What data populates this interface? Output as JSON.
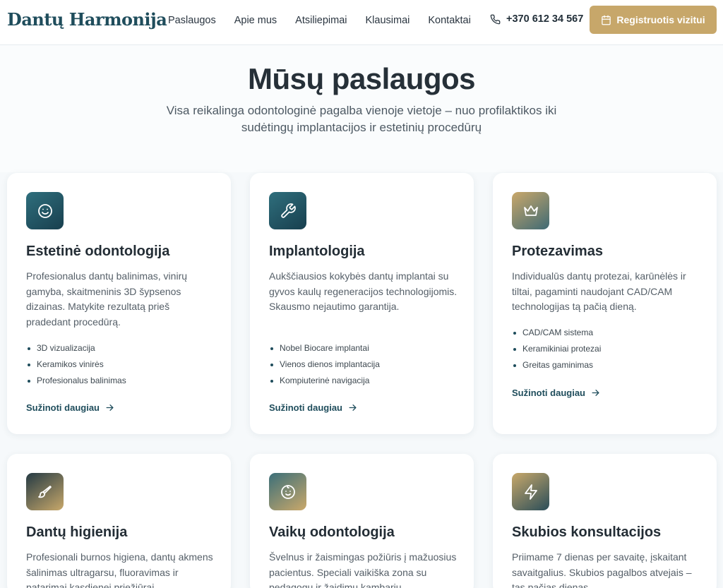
{
  "header": {
    "logo": "Dantų Harmonija",
    "nav": [
      "Paslaugos",
      "Apie mus",
      "Atsiliepimai",
      "Klausimai",
      "Kontaktai"
    ],
    "phone": "+370 612 34 567",
    "cta_label": "Registruotis vizitui"
  },
  "hero": {
    "title": "Mūsų paslaugos",
    "subtitle": "Visa reikalinga odontologinė pagalba vienoje vietoje – nuo profilaktikos iki sudėtingų implantacijos ir estetinių procedūrų"
  },
  "cards": [
    {
      "icon": "smile-icon",
      "title": "Estetinė odontologija",
      "text": "Profesionalus dantų balinimas, vinirų gamyba, skaitmeninis 3D šypsenos dizainas. Matykite rezultatą prieš pradedant procedūrą.",
      "features": [
        "3D vizualizacija",
        "Keramikos vinirės",
        "Profesionalus balinimas"
      ],
      "link": "Sužinoti daugiau"
    },
    {
      "icon": "wrench-icon",
      "title": "Implantologija",
      "text": "Aukščiausios kokybės dantų implantai su gyvos kaulų regeneracijos technologijomis. Skausmo nejautimo garantija.",
      "features": [
        "Nobel Biocare implantai",
        "Vienos dienos implantacija",
        "Kompiuterinė navigacija"
      ],
      "link": "Sužinoti daugiau"
    },
    {
      "icon": "crown-icon",
      "title": "Protezavimas",
      "text": "Individualūs dantų protezai, karūnėlės ir tiltai, pagaminti naudojant CAD/CAM technologijas tą pačią dieną.",
      "features": [
        "CAD/CAM sistema",
        "Keramikiniai protezai",
        "Greitas gaminimas"
      ],
      "link": "Sužinoti daugiau"
    },
    {
      "icon": "brush-icon",
      "title": "Dantų higienija",
      "text": "Profesionali burnos higiena, dantų akmens šalinimas ultragarsu, fluoravimas ir patarimai kasdienei priežiūrai."
    },
    {
      "icon": "baby-icon",
      "title": "Vaikų odontologija",
      "text": "Švelnus ir žaismingas požiūris į mažuosius pacientus. Speciali vaikiška zona su pedagogu ir žaidimų kambariu."
    },
    {
      "icon": "lightning-icon",
      "title": "Skubios konsultacijos",
      "text": "Priimame 7 dienas per savaitę, įskaitant savaitgalius. Skubios pagalbos atvejais – tas pačias dienas."
    }
  ],
  "colors": {
    "accent": "#c7a76a",
    "brand": "#1f4d5c"
  }
}
